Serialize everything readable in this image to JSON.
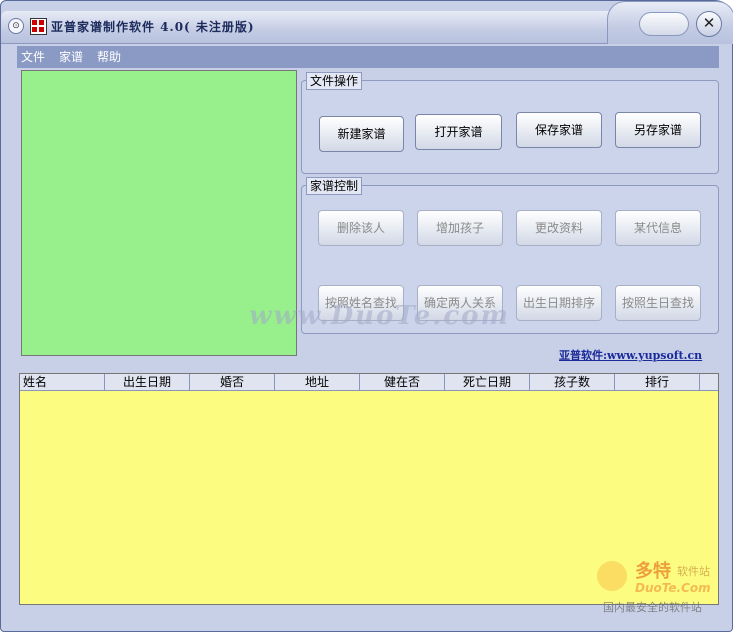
{
  "window": {
    "title": "亚普家谱制作软件 4.0( 未注册版)",
    "close_symbol": "✕",
    "sysmenu_symbol": "⊙"
  },
  "menubar": {
    "items": [
      {
        "label": "文件"
      },
      {
        "label": "家谱"
      },
      {
        "label": "帮助"
      }
    ]
  },
  "file_ops": {
    "legend": "文件操作",
    "buttons": [
      {
        "label": "新建家谱"
      },
      {
        "label": "打开家谱"
      },
      {
        "label": "保存家谱"
      },
      {
        "label": "另存家谱"
      }
    ]
  },
  "family_ctrl": {
    "legend": "家谱控制",
    "buttons": [
      {
        "label": "删除该人"
      },
      {
        "label": "增加孩子"
      },
      {
        "label": "更改资料"
      },
      {
        "label": "某代信息"
      },
      {
        "label": "按照姓名查找"
      },
      {
        "label": "确定两人关系"
      },
      {
        "label": "出生日期排序"
      },
      {
        "label": "按照生日查找"
      }
    ]
  },
  "website_link": "亚普软件:www.yupsoft.cn",
  "table": {
    "columns": [
      "姓名",
      "出生日期",
      "婚否",
      "地址",
      "健在否",
      "死亡日期",
      "孩子数",
      "排行"
    ]
  },
  "watermark": {
    "center_text": "www.DuoTe.com",
    "logo_cn": "多特",
    "logo_sub": "软件站",
    "logo_en": "DuoTe.Com",
    "logo_slogan": "国内最安全的软件站"
  },
  "colors": {
    "tree_bg": "#98f08c",
    "table_bg": "#fcfc80",
    "menubar_bg": "#8a9ac4"
  }
}
